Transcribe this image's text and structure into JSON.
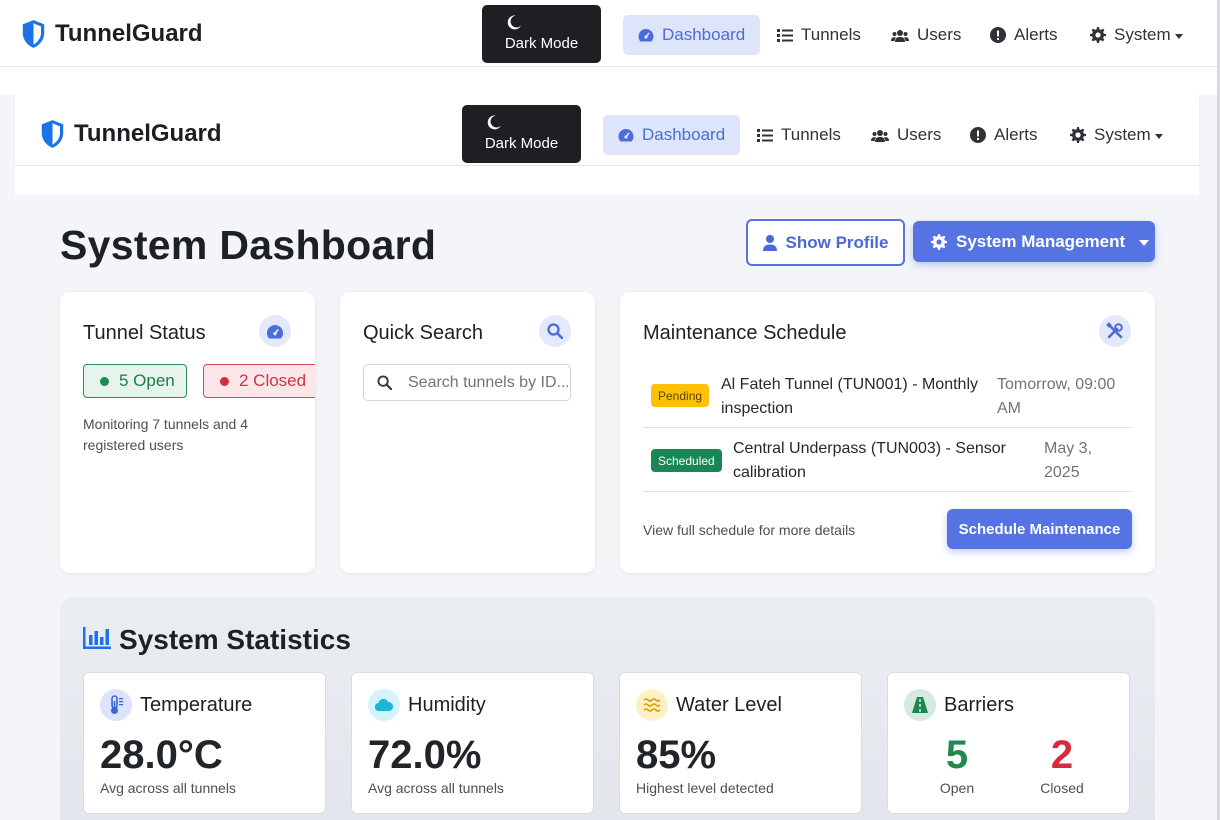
{
  "navbar": {
    "brand": "TunnelGuard",
    "dark_mode_label": "Dark Mode",
    "items": [
      {
        "label": "Dashboard",
        "icon": "gauge-icon",
        "active": true
      },
      {
        "label": "Tunnels",
        "icon": "list-icon"
      },
      {
        "label": "Users",
        "icon": "users-icon"
      },
      {
        "label": "Alerts",
        "icon": "exclamation-circle-icon"
      },
      {
        "label": "System",
        "icon": "gear-icon",
        "dropdown": true
      }
    ]
  },
  "header": {
    "title": "System Dashboard",
    "show_profile": "Show Profile",
    "system_management": "System Management"
  },
  "tunnel_status": {
    "title": "Tunnel Status",
    "open_label": "5 Open",
    "closed_label": "2 Closed",
    "summary": "Monitoring 7 tunnels and 4 registered users"
  },
  "quick_search": {
    "title": "Quick Search",
    "placeholder": "Search tunnels by ID..."
  },
  "maintenance": {
    "title": "Maintenance Schedule",
    "items": [
      {
        "badge": "Pending",
        "description": "Al Fateh Tunnel (TUN001) - Monthly inspection",
        "date": "Tomorrow, 09:00 AM"
      },
      {
        "badge": "Scheduled",
        "description": "Central Underpass (TUN003) - Sensor calibration",
        "date": "May 3, 2025"
      }
    ],
    "footer_note": "View full schedule for more details",
    "button": "Schedule Maintenance"
  },
  "statistics": {
    "title": "System Statistics",
    "cards": [
      {
        "label": "Temperature",
        "value": "28.0°C",
        "sub": "Avg across all tunnels",
        "icon": "thermometer-icon"
      },
      {
        "label": "Humidity",
        "value": "72.0%",
        "sub": "Avg across all tunnels",
        "icon": "cloud-icon"
      },
      {
        "label": "Water Level",
        "value": "85%",
        "sub": "Highest level detected",
        "icon": "water-icon"
      }
    ],
    "barriers": {
      "label": "Barriers",
      "open_value": "5",
      "open_label": "Open",
      "closed_value": "2",
      "closed_label": "Closed",
      "icon": "road-icon"
    }
  },
  "colors": {
    "accent": "#5573e3",
    "open_green": "#1f8a4f",
    "closed_red": "#d42b3d",
    "pending_yellow": "#ffc107",
    "scheduled_green": "#198754"
  }
}
